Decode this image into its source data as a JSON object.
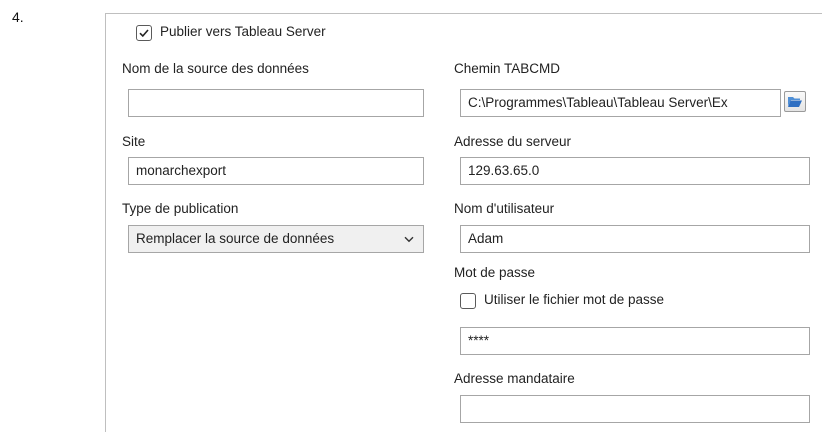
{
  "step": {
    "number": "4."
  },
  "publish": {
    "checkbox_label": "Publier vers Tableau Server",
    "checked": true
  },
  "left": {
    "datasource_name": {
      "label": "Nom de la source des données",
      "value": ""
    },
    "site": {
      "label": "Site",
      "value": "monarchexport"
    },
    "publication_type": {
      "label": "Type de publication",
      "selected": "Remplacer la source de données"
    }
  },
  "right": {
    "tabcmd_path": {
      "label": "Chemin TABCMD",
      "value": "C:\\Programmes\\Tableau\\Tableau Server\\Ex"
    },
    "server_address": {
      "label": "Adresse du serveur",
      "value": "129.63.65.0"
    },
    "username": {
      "label": "Nom d'utilisateur",
      "value": "Adam"
    },
    "password": {
      "label": "Mot de passe",
      "use_file_label": "Utiliser le fichier mot de passe",
      "use_file_checked": false,
      "value": "****"
    },
    "proxy_address": {
      "label": "Adresse mandataire",
      "value": ""
    }
  },
  "icons": {
    "browse": "folder-open-icon",
    "dropdown": "chevron-down-icon",
    "check": "checkmark-icon"
  }
}
